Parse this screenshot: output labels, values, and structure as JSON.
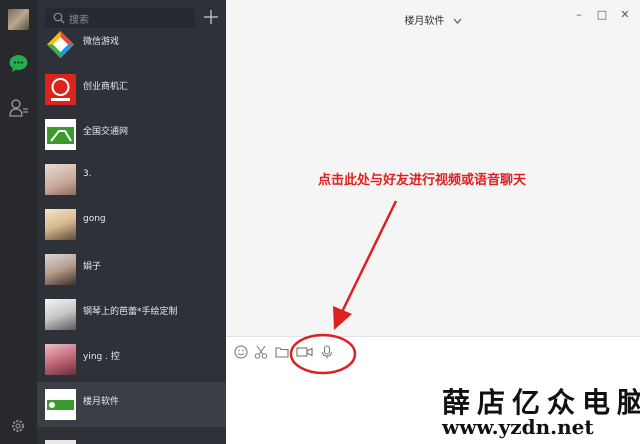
{
  "search": {
    "placeholder": "搜索"
  },
  "chats": [
    {
      "name": "微信游戏"
    },
    {
      "name": "创业商机汇"
    },
    {
      "name": "全国交通网"
    },
    {
      "name": "3."
    },
    {
      "name": "gong"
    },
    {
      "name": "娟子"
    },
    {
      "name": "钢琴上的芭蕾*手绘定制"
    },
    {
      "name": "ying . 控"
    },
    {
      "name": "楼月软件"
    }
  ],
  "header": {
    "title": "楼月软件",
    "minimize": "–",
    "maximize": "□",
    "close": "✕"
  },
  "annotation": {
    "text": "点击此处与好友进行视频或语音聊天"
  },
  "watermark": {
    "site_name": "薛店亿众电脑",
    "url": "www.yzdn.net"
  },
  "colors": {
    "annotation": "#e02020",
    "wechat_green": "#21b04b",
    "sidebar": "#28292c",
    "list": "#2e3238"
  }
}
